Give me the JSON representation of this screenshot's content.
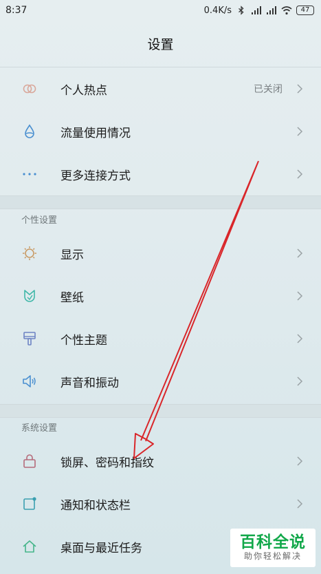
{
  "status_bar": {
    "time": "8:37",
    "net_speed": "0.4K/s",
    "battery": "47",
    "icons": [
      "bluetooth-icon",
      "signal-icon",
      "signal-icon",
      "wifi-icon",
      "battery-icon"
    ]
  },
  "header": {
    "title": "设置"
  },
  "group1": {
    "items": [
      {
        "label": "个人热点",
        "value": "已关闭",
        "icon": "hotspot-icon"
      },
      {
        "label": "流量使用情况",
        "value": "",
        "icon": "data-usage-icon"
      },
      {
        "label": "更多连接方式",
        "value": "",
        "icon": "more-dots-icon"
      }
    ]
  },
  "section_personal": {
    "title": "个性设置",
    "items": [
      {
        "label": "显示",
        "icon": "sun-icon"
      },
      {
        "label": "壁纸",
        "icon": "wallpaper-icon"
      },
      {
        "label": "个性主题",
        "icon": "theme-brush-icon"
      },
      {
        "label": "声音和振动",
        "icon": "speaker-icon"
      }
    ]
  },
  "section_system": {
    "title": "系统设置",
    "items": [
      {
        "label": "锁屏、密码和指纹",
        "icon": "lock-icon"
      },
      {
        "label": "通知和状态栏",
        "icon": "notification-icon"
      },
      {
        "label": "桌面与最近任务",
        "icon": "home-icon"
      }
    ]
  },
  "watermark": {
    "main": "百科全说",
    "sub": "助你轻松解决"
  },
  "colors": {
    "accent_blue": "#4a8fd0",
    "hotspot_orange": "#d9a79a",
    "sun_orange": "#c99b66",
    "wallpaper_teal": "#3fb7a8",
    "theme_blue": "#6d83c4",
    "lock_red": "#b56a7a",
    "notify_teal": "#3a9fb0",
    "home_green": "#45b58a",
    "arrow_red": "#d9262a",
    "watermark_green": "#12a84a"
  }
}
